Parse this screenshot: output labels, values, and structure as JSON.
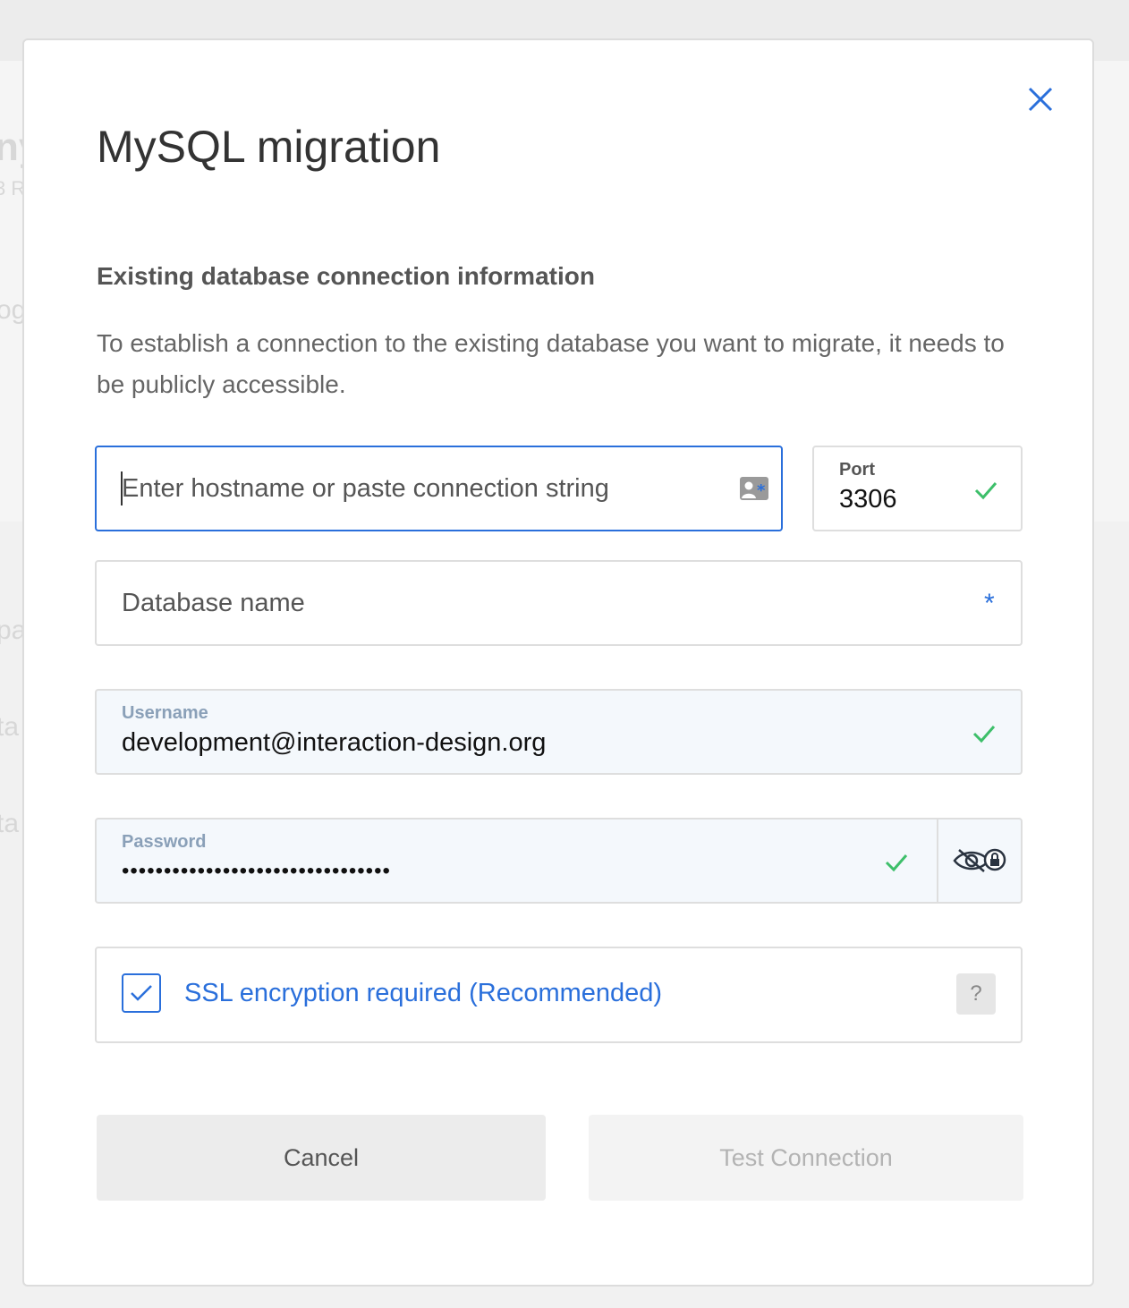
{
  "dialog": {
    "title": "MySQL migration",
    "close_icon": "close-icon",
    "section_heading": "Existing database connection information",
    "section_description": "To establish a connection to the existing database you want to migrate, it needs to be publicly accessible."
  },
  "fields": {
    "hostname": {
      "placeholder": "Enter hostname or paste connection string",
      "value": "",
      "icon": "contact-card-icon"
    },
    "port": {
      "label": "Port",
      "value": "3306"
    },
    "database_name": {
      "placeholder": "Database name",
      "required_mark": "*"
    },
    "username": {
      "label": "Username",
      "value": "development@interaction-design.org"
    },
    "password": {
      "label": "Password",
      "masked_value": "••••••••••••••••••••••••••••••••",
      "toggle_icon": "hide-password-icon"
    }
  },
  "ssl": {
    "label": "SSL encryption required (Recommended)",
    "checked": true,
    "help": "?"
  },
  "actions": {
    "cancel_label": "Cancel",
    "test_label": "Test Connection"
  },
  "colors": {
    "accent": "#2a6fdb",
    "success": "#3dbf6a",
    "filled_bg": "#f4f8fc"
  },
  "background": {
    "fragments": [
      "ny",
      "3 R",
      "og",
      "pa",
      "ta",
      "ta"
    ]
  }
}
